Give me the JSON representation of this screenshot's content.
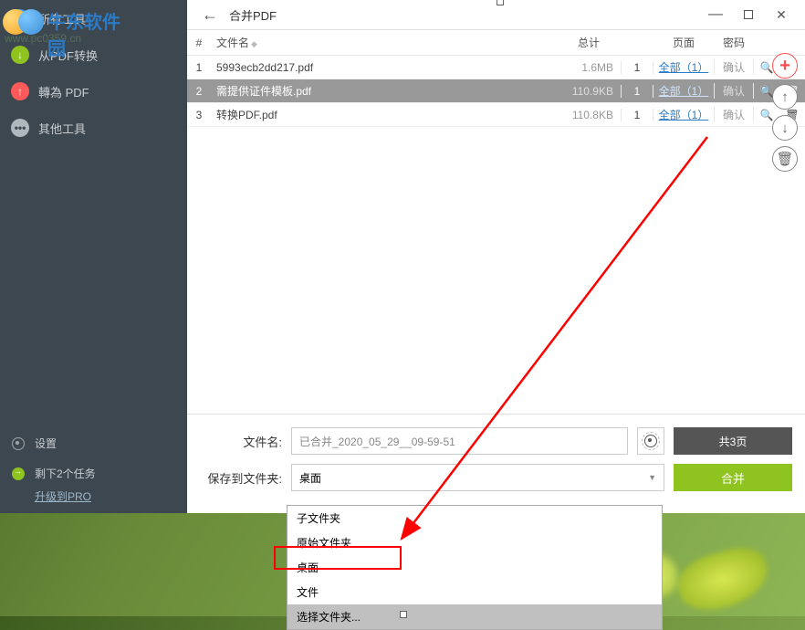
{
  "window": {
    "title": "合并PDF",
    "logo_text": "牛东软件园",
    "watermark": "www.pc0359.cn"
  },
  "sidebar": {
    "items": [
      {
        "label": "所有工具"
      },
      {
        "label": "从PDF转换"
      },
      {
        "label": "轉為 PDF"
      },
      {
        "label": "其他工具"
      }
    ],
    "settings": "设置",
    "tasks": "剩下2个任务",
    "upgrade": "升级到PRO"
  },
  "table": {
    "headers": {
      "num": "#",
      "name": "文件名",
      "total": "总计",
      "pages": "页面",
      "pwd": "密码"
    },
    "rows": [
      {
        "num": "1",
        "name": "5993ecb2dd217.pdf",
        "total": "1.6MB",
        "count": "1",
        "pages": "全部（1）",
        "pwd": "确认"
      },
      {
        "num": "2",
        "name": "需提供证件模板.pdf",
        "total": "110.9KB",
        "count": "1",
        "pages": "全部（1）",
        "pwd": "确认"
      },
      {
        "num": "3",
        "name": "转换PDF.pdf",
        "total": "110.8KB",
        "count": "1",
        "pages": "全部（1）",
        "pwd": "确认"
      }
    ]
  },
  "controls": {
    "filename_label": "文件名:",
    "filename_value": "已合并_2020_05_29__09-59-51",
    "save_label": "保存到文件夹:",
    "save_value": "桌面",
    "pages_btn": "共3页",
    "merge_btn": "合并"
  },
  "dropdown": {
    "items": [
      "子文件夹",
      "原始文件夹",
      "桌面",
      "文件",
      "选择文件夹..."
    ]
  }
}
